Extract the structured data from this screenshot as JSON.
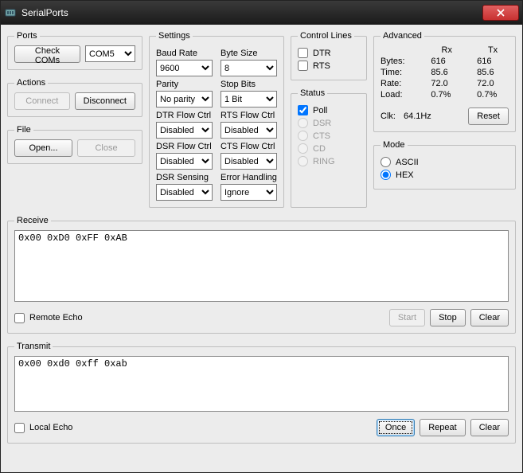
{
  "window": {
    "title": "SerialPorts"
  },
  "ports": {
    "legend": "Ports",
    "check": "Check COMs",
    "selected": "COM5"
  },
  "actions": {
    "legend": "Actions",
    "connect": "Connect",
    "disconnect": "Disconnect"
  },
  "file": {
    "legend": "File",
    "open": "Open...",
    "close": "Close"
  },
  "settings": {
    "legend": "Settings",
    "baud_label": "Baud Rate",
    "baud": "9600",
    "byte_label": "Byte Size",
    "byte": "8",
    "parity_label": "Parity",
    "parity": "No parity",
    "stop_label": "Stop Bits",
    "stop": "1 Bit",
    "dtrflow_label": "DTR Flow Ctrl",
    "dtrflow": "Disabled",
    "rtsflow_label": "RTS Flow Ctrl",
    "rtsflow": "Disabled",
    "dsrflow_label": "DSR Flow Ctrl",
    "dsrflow": "Disabled",
    "ctsflow_label": "CTS Flow Ctrl",
    "ctsflow": "Disabled",
    "dsrsens_label": "DSR Sensing",
    "dsrsens": "Disabled",
    "err_label": "Error Handling",
    "err": "Ignore"
  },
  "control": {
    "legend": "Control Lines",
    "dtr": "DTR",
    "rts": "RTS"
  },
  "status": {
    "legend": "Status",
    "poll": "Poll",
    "dsr": "DSR",
    "cts": "CTS",
    "cd": "CD",
    "ring": "RING"
  },
  "advanced": {
    "legend": "Advanced",
    "rx_hdr": "Rx",
    "tx_hdr": "Tx",
    "bytes_label": "Bytes:",
    "bytes_rx": "616",
    "bytes_tx": "616",
    "time_label": "Time:",
    "time_rx": "85.6",
    "time_tx": "85.6",
    "rate_label": "Rate:",
    "rate_rx": "72.0",
    "rate_tx": "72.0",
    "load_label": "Load:",
    "load_rx": "0.7%",
    "load_tx": "0.7%",
    "clk_label": "Clk:",
    "clk_val": "64.1Hz",
    "reset": "Reset"
  },
  "mode": {
    "legend": "Mode",
    "ascii": "ASCII",
    "hex": "HEX"
  },
  "receive": {
    "legend": "Receive",
    "content": "0x00 0xD0 0xFF 0xAB",
    "remote_echo": "Remote Echo",
    "start": "Start",
    "stop": "Stop",
    "clear": "Clear"
  },
  "transmit": {
    "legend": "Transmit",
    "content": "0x00 0xd0 0xff 0xab",
    "local_echo": "Local Echo",
    "once": "Once",
    "repeat": "Repeat",
    "clear": "Clear"
  }
}
